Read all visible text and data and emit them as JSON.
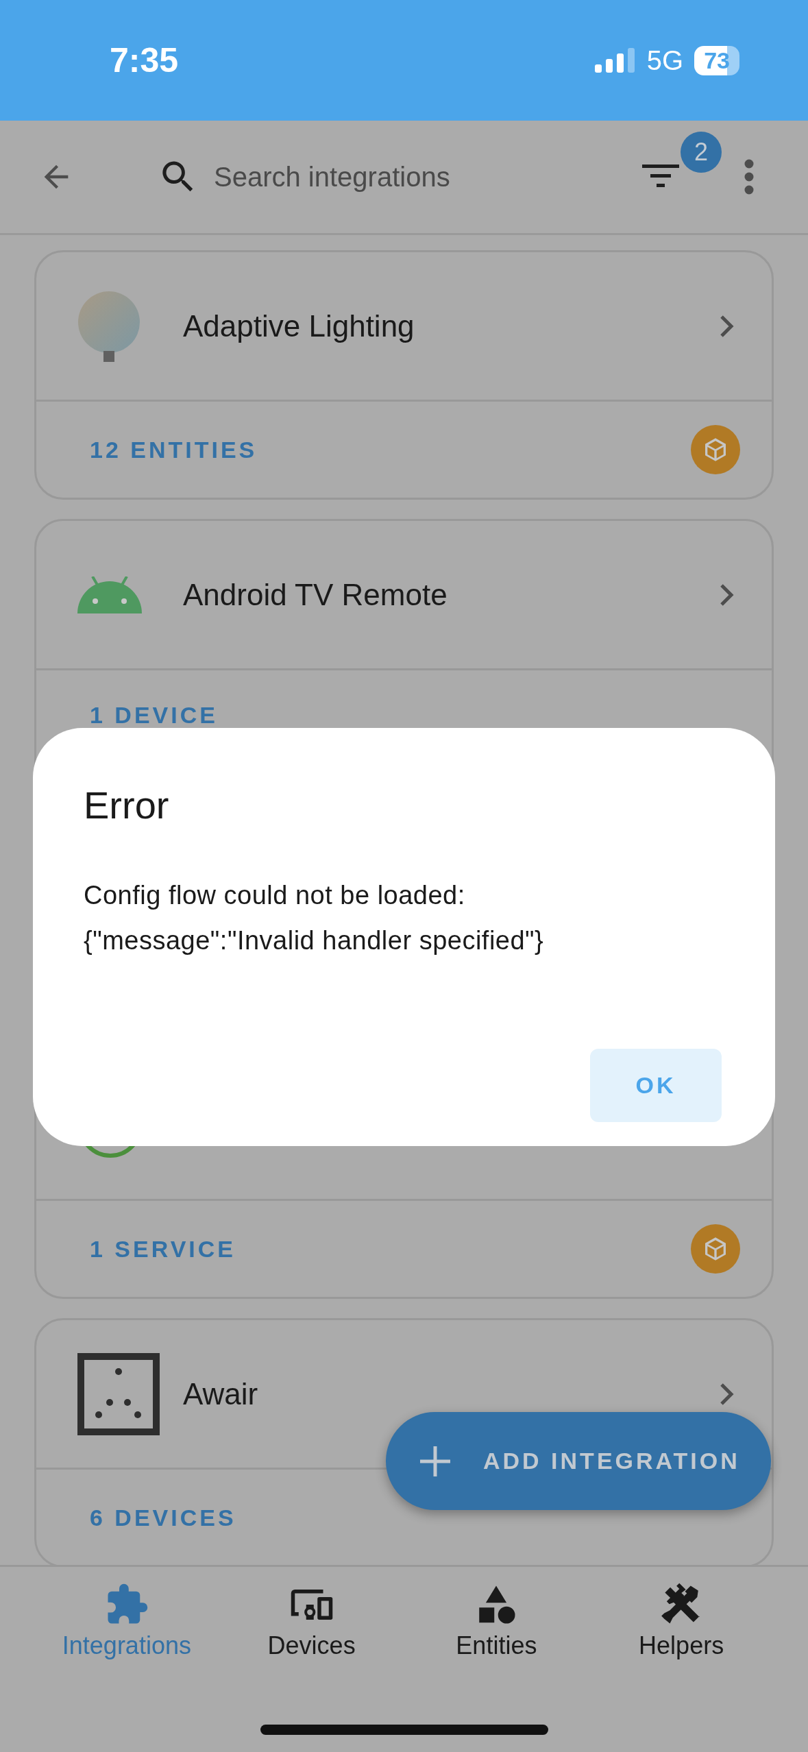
{
  "status_bar": {
    "time": "7:35",
    "network": "5G",
    "battery": "73"
  },
  "header": {
    "search": {
      "placeholder": "Search integrations"
    },
    "filter_badge": "2"
  },
  "integrations": [
    {
      "kind": "bulb",
      "name": "Adaptive Lighting",
      "footer": "12 ENTITIES",
      "custom": true
    },
    {
      "kind": "android",
      "name": "Android TV Remote",
      "footer": "1 DEVICE",
      "custom": false
    },
    {
      "kind": "ring",
      "footer": "1 SERVICE",
      "custom": true
    },
    {
      "kind": "awair",
      "name": "Awair",
      "footer": "6 DEVICES",
      "custom": false
    }
  ],
  "dialog": {
    "title": "Error",
    "message": "Config flow could not be loaded:\n{\"message\":\"Invalid handler specified\"}",
    "buttons": [
      "OK"
    ]
  },
  "fab": {
    "label": "ADD INTEGRATION"
  },
  "bottom_nav": [
    {
      "kind": "integrations",
      "label": "Integrations",
      "selected": true
    },
    {
      "kind": "devices",
      "label": "Devices",
      "selected": false
    },
    {
      "kind": "entities",
      "label": "Entities",
      "selected": false
    },
    {
      "kind": "helpers",
      "label": "Helpers",
      "selected": false
    }
  ]
}
